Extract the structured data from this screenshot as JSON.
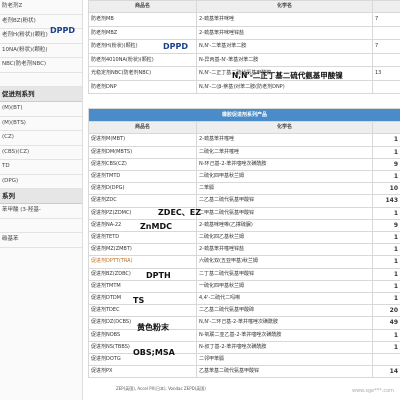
{
  "sidebar": {
    "items": [
      {
        "label": "防老剂Z",
        "kind": "item"
      },
      {
        "label": "老剂BZ(粉状)",
        "kind": "item"
      },
      {
        "label": "老剂H(粉状)(颗粒)",
        "kind": "item"
      },
      {
        "label": "10NA(粉状)(颗粒)",
        "kind": "item"
      },
      {
        "label": "NBC(防老剂NBC)",
        "kind": "item"
      },
      {
        "label": "",
        "kind": "item"
      },
      {
        "label": "促进剂系列",
        "kind": "head"
      },
      {
        "label": "(M)(BT)",
        "kind": "item"
      },
      {
        "label": "(M)(BTS)",
        "kind": "item"
      },
      {
        "label": "(CZ)",
        "kind": "item"
      },
      {
        "label": "(CBS)(CZ)",
        "kind": "item"
      },
      {
        "label": "TD",
        "kind": "item"
      },
      {
        "label": "(DPG)",
        "kind": "item"
      },
      {
        "label": "系列",
        "kind": "head"
      },
      {
        "label": "苯甲酸 (3-羟基-",
        "kind": "item"
      },
      {
        "label": "",
        "kind": "item"
      },
      {
        "label": "碳基苯",
        "kind": "item"
      }
    ]
  },
  "table1": {
    "headers": [
      "商品名",
      "化学名",
      ""
    ],
    "rows": [
      [
        "防老剂MB",
        "2-巯基苯并咪唑",
        "7"
      ],
      [
        "防老剂MBZ",
        "2-巯基苯并咪唑锌盐",
        ""
      ],
      [
        "防老剂H(粉状)(颗粒)",
        "N,N'-二苯基对苯二胺",
        "7"
      ],
      [
        "防老剂4010NA(粉状)(颗粒)",
        "N-异丙基-N'-苯基对苯二胺",
        ""
      ],
      [
        "光稳定剂NBC(防老剂NBC)",
        "N,N'-二正丁基二硫代氨基甲酸镍",
        "13"
      ],
      [
        "防老剂DNP",
        "N,N'-二(β-萘基)对苯二胺(防老剂DNP)",
        ""
      ]
    ]
  },
  "table2": {
    "title": "橡胶促进剂系列产品",
    "headers": [
      "商品名",
      "化学名",
      ""
    ],
    "rows": [
      [
        "促进剂M(MBT)",
        "2-巯基苯并噻唑",
        "1"
      ],
      [
        "促进剂DM(MBTS)",
        "二硫化二苯并噻唑",
        "1"
      ],
      [
        "促进剂CBS(CZ)",
        "N-环己基-2-苯并噻唑次磺酰胺",
        "9"
      ],
      [
        "促进剂TMTD",
        "二硫化四甲基秋兰姆",
        "1"
      ],
      [
        "促进剂D(DPG)",
        "二苯胍",
        "10"
      ],
      [
        "促进剂ZDC",
        "二乙基二硫代氨基甲酸锌",
        "143"
      ],
      [
        "促进剂PZ(ZDMC)",
        "二甲基二硫代氨基甲酸锌",
        "1"
      ],
      [
        "促进剂NA-22",
        "2-巯基咪唑啉(乙撑硫脲)",
        "9"
      ],
      [
        "促进剂TETD",
        "二硫化四乙基秋兰姆",
        "1"
      ],
      [
        "促进剂MZ(ZMBT)",
        "2-巯基苯并噻唑锌盐",
        "1"
      ],
      [
        "促进剂DPTT(TRA)",
        "六硫化双(五亚甲基)秋兰姆",
        "1"
      ],
      [
        "促进剂BZ(ZDBC)",
        "二丁基二硫代氨基甲酸锌",
        "1"
      ],
      [
        "促进剂TMTM",
        "一硫化四甲基秋兰姆",
        "1"
      ],
      [
        "促进剂DTDM",
        "4,4'-二硫代二吗啉",
        "1"
      ],
      [
        "促进剂TDEC",
        "二乙基二硫代氨基甲酸碲",
        "20"
      ],
      [
        "促进剂DZ(DCBS)",
        "N,N'-二环己基-2-苯并噻唑次磺酰胺",
        "49"
      ],
      [
        "促进剂NOBS",
        "N-氧联二亚乙基-2-苯并噻唑次磺酰胺",
        "1"
      ],
      [
        "促进剂NS(TBBS)",
        "N-叔丁基-2-苯并噻唑次磺酰胺",
        "1"
      ],
      [
        "促进剂DOTG",
        "二邻甲苯胍",
        ""
      ],
      [
        "促进剂PX",
        "乙基苯基二硫代氨基甲酸锌",
        "14"
      ]
    ]
  },
  "overlays": {
    "dppd_left": "DPPD",
    "dppd_mid": "DPPD",
    "nbc_label": "N,N'-二正丁基二硫代氨基甲酸镍",
    "zdec_ez": "ZDEC、EZ",
    "znmdc": "ZnMDC",
    "dpth": "DPTH",
    "ts": "TS",
    "yellow_powder": "黄色粉末",
    "obs_msa": "OBS;MSA",
    "zep_note": "ZEP(英国), Accel PX(日本), Vondac ZEPD(英国)",
    "watermark": "www.sge***.com"
  }
}
